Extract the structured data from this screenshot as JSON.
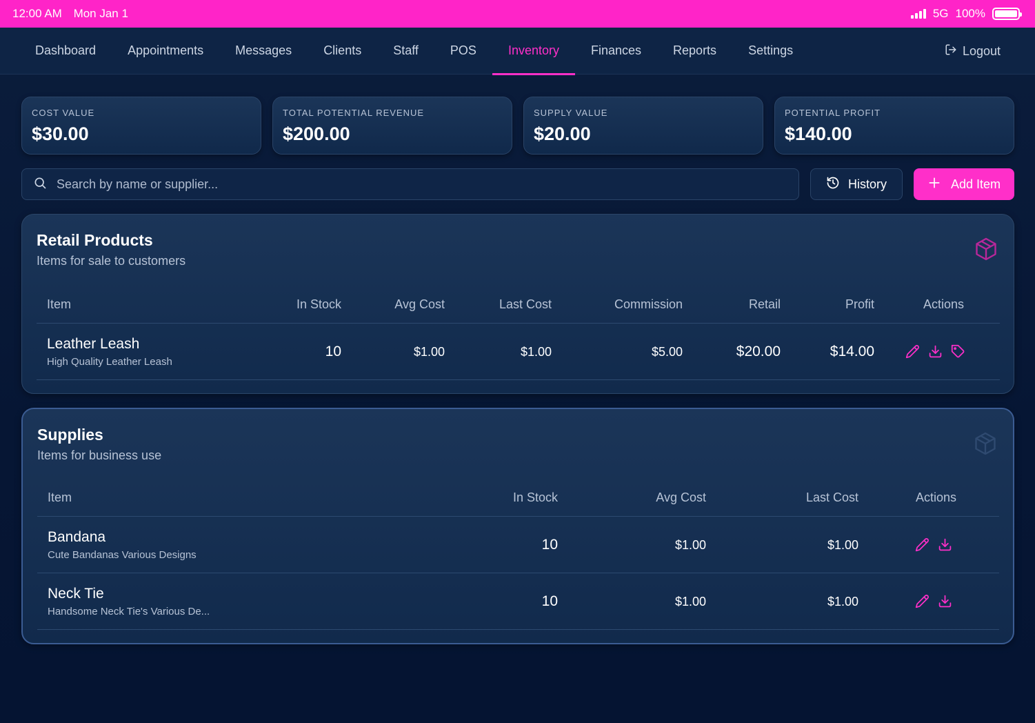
{
  "status_bar": {
    "time": "12:00 AM",
    "date": "Mon Jan 1",
    "network": "5G",
    "battery": "100%",
    "battery_level": 1.0
  },
  "nav": {
    "items": [
      {
        "label": "Dashboard"
      },
      {
        "label": "Appointments"
      },
      {
        "label": "Messages"
      },
      {
        "label": "Clients"
      },
      {
        "label": "Staff"
      },
      {
        "label": "POS"
      },
      {
        "label": "Inventory",
        "active": true
      },
      {
        "label": "Finances"
      },
      {
        "label": "Reports"
      },
      {
        "label": "Settings"
      }
    ],
    "logout_label": "Logout"
  },
  "stats": [
    {
      "label": "COST VALUE",
      "value": "$30.00"
    },
    {
      "label": "TOTAL POTENTIAL REVENUE",
      "value": "$200.00"
    },
    {
      "label": "SUPPLY VALUE",
      "value": "$20.00"
    },
    {
      "label": "POTENTIAL PROFIT",
      "value": "$140.00"
    }
  ],
  "toolbar": {
    "search_placeholder": "Search by name or supplier...",
    "history_label": "History",
    "add_label": "Add Item"
  },
  "retail": {
    "title": "Retail Products",
    "subtitle": "Items for sale to customers",
    "columns": [
      "Item",
      "In Stock",
      "Avg Cost",
      "Last Cost",
      "Commission",
      "Retail",
      "Profit",
      "Actions"
    ],
    "rows": [
      {
        "name": "Leather Leash",
        "description": "High Quality Leather Leash",
        "in_stock": "10",
        "avg_cost": "$1.00",
        "last_cost": "$1.00",
        "commission": "$5.00",
        "retail": "$20.00",
        "profit": "$14.00"
      }
    ]
  },
  "supplies": {
    "title": "Supplies",
    "subtitle": "Items for business use",
    "columns": [
      "Item",
      "In Stock",
      "Avg Cost",
      "Last Cost",
      "Actions"
    ],
    "rows": [
      {
        "name": "Bandana",
        "description": "Cute Bandanas Various Designs",
        "in_stock": "10",
        "avg_cost": "$1.00",
        "last_cost": "$1.00"
      },
      {
        "name": "Neck Tie",
        "description": "Handsome Neck Tie's Various De...",
        "in_stock": "10",
        "avg_cost": "$1.00",
        "last_cost": "$1.00"
      }
    ]
  },
  "colors": {
    "accent": "#ff2fc9",
    "background": "#061634",
    "panel": "#1b3558"
  }
}
